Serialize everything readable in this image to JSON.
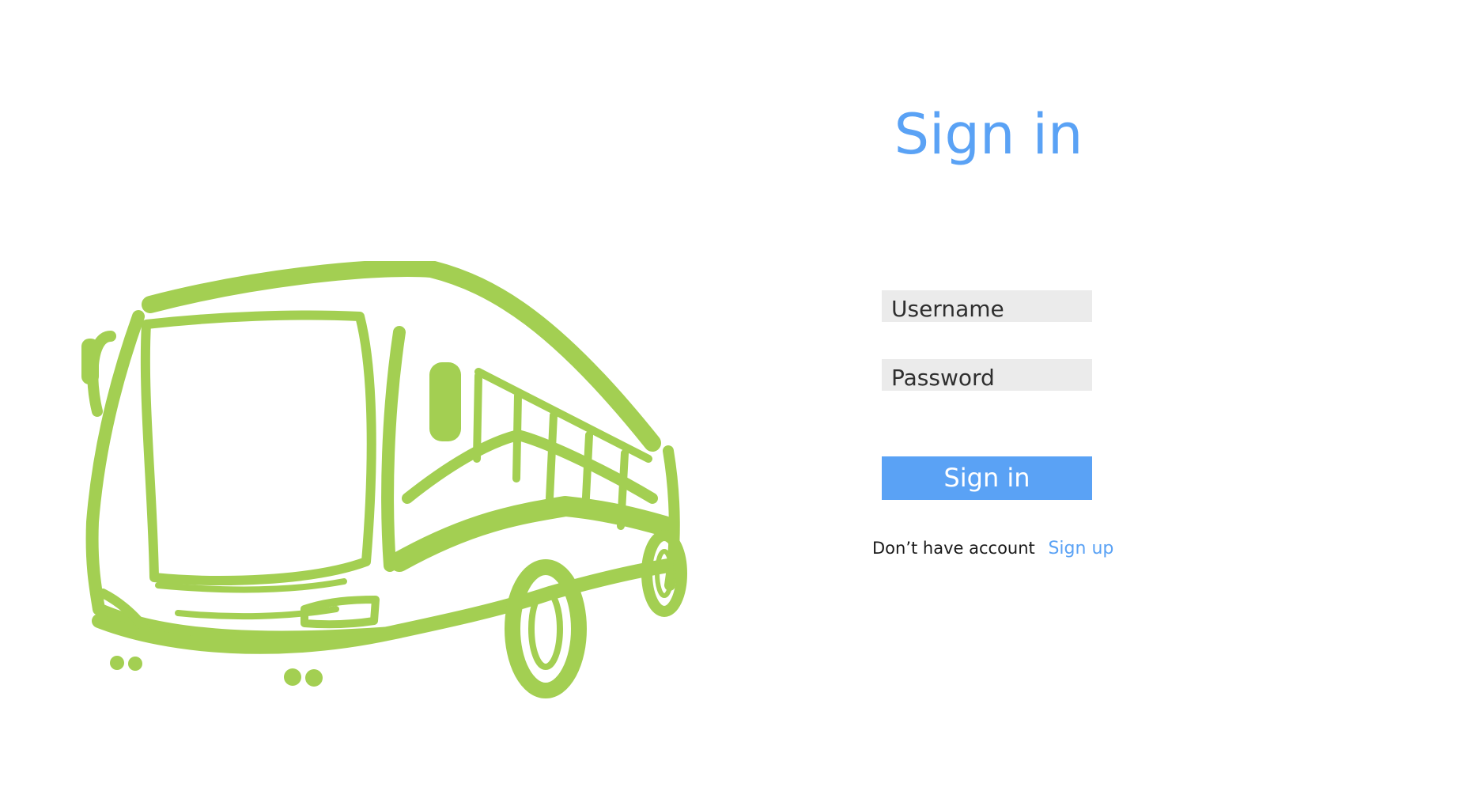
{
  "page": {
    "title": "Sign in",
    "accent_color": "#5aa2f5",
    "illustration_color": "#a3cf52"
  },
  "illustration": {
    "icon": "bus-icon"
  },
  "form": {
    "username_placeholder": "Username",
    "password_placeholder": "Password",
    "submit_label": "Sign in",
    "no_account_text": "Don’t have account",
    "signup_link": "Sign up"
  }
}
